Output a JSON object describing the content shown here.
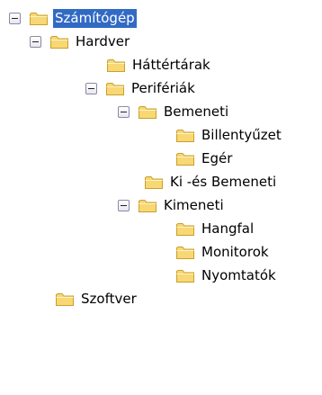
{
  "tree": {
    "nodes": [
      {
        "label": "Számítógép",
        "expanded": true,
        "selected": true
      },
      {
        "label": "Hardver",
        "expanded": true
      },
      {
        "label": "Háttértárak"
      },
      {
        "label": "Perifériák",
        "expanded": true
      },
      {
        "label": "Bemeneti",
        "expanded": true
      },
      {
        "label": "Billentyűzet"
      },
      {
        "label": "Egér"
      },
      {
        "label": "Ki -és Bemeneti"
      },
      {
        "label": "Kimeneti",
        "expanded": true
      },
      {
        "label": "Hangfal"
      },
      {
        "label": "Monitorok"
      },
      {
        "label": "Nyomtatók"
      },
      {
        "label": "Szoftver"
      }
    ]
  },
  "icons": {
    "expander": "minus-box-icon",
    "folder": "folder-icon"
  },
  "colors": {
    "selection_bg": "#316ac5",
    "selection_text": "#ffffff",
    "folder_fill": "#f8d775",
    "folder_stroke": "#c9a02a"
  }
}
